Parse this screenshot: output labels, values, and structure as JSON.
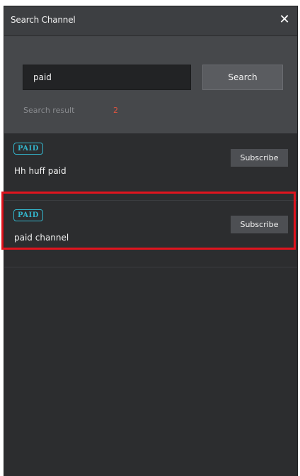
{
  "dialog": {
    "title": "Search Channel",
    "close_glyph": "✕"
  },
  "search": {
    "query": "paid",
    "button_label": "Search",
    "result_label": "Search result",
    "result_count": "2"
  },
  "results": [
    {
      "badge": "PAID",
      "name": "Hh huff paid",
      "subscribe_label": "Subscribe"
    },
    {
      "badge": "PAID",
      "name": "paid channel",
      "subscribe_label": "Subscribe"
    }
  ],
  "colors": {
    "accent": "#33b3c9",
    "count": "#e0533f",
    "highlight": "#e0141e"
  }
}
